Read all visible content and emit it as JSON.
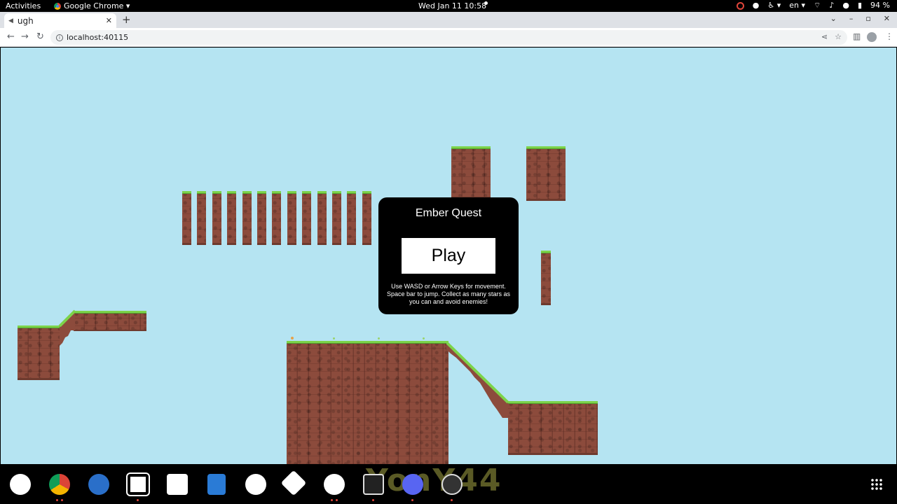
{
  "topbar": {
    "activities": "Activities",
    "app_name": "Google Chrome ▾",
    "clock": "Wed Jan 11  10:58",
    "lang": "en ▾",
    "battery": "94 %"
  },
  "browser": {
    "tab_title": "ugh",
    "url": "localhost:40115"
  },
  "game": {
    "modal": {
      "title": "Ember Quest",
      "play_label": "Play",
      "help": "Use WASD or Arrow Keys for movement. Space bar to jump. Collect as many stars as you can and avoid enemies!"
    },
    "colors": {
      "sky": "#b5e4f2",
      "dirt": "#8c4b3c",
      "grass": "#7cd34a"
    }
  },
  "dock": {
    "watermark": "YonY44",
    "apps": [
      "refresh-icon",
      "chrome-icon",
      "thunderbird-icon",
      "files-icon",
      "screenshot-icon",
      "writer-icon",
      "help-icon",
      "move-icon",
      "inkscape-icon",
      "terminal-icon",
      "discord-icon",
      "obs-icon"
    ]
  }
}
